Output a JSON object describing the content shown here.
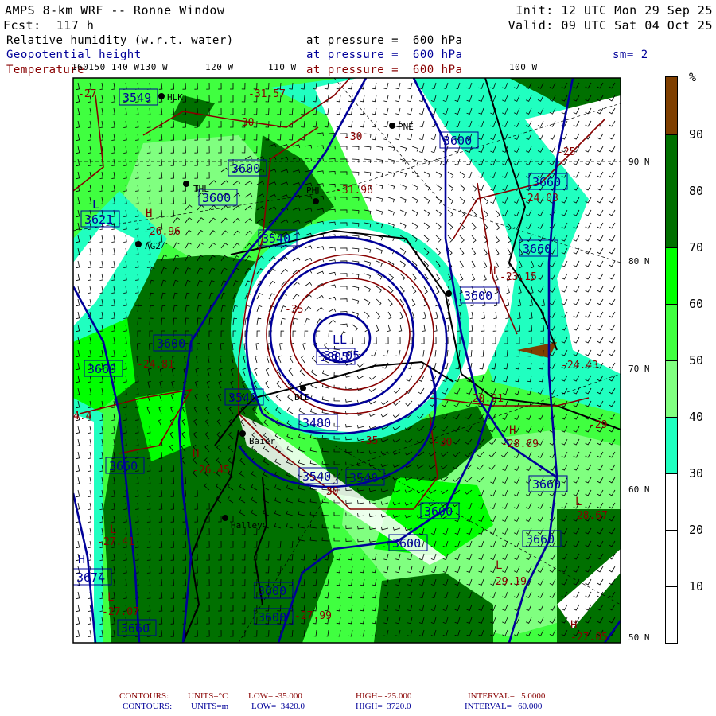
{
  "header": {
    "title": "AMPS 8-km WRF -- Ronne Window",
    "init": "Init: 12 UTC Mon 29 Sep 25",
    "forecast": "Fcst:  117 h",
    "valid": "Valid: 09 UTC Sat 04 Oct 25",
    "fields": [
      {
        "name": "Relative humidity (w.r.t. water)",
        "level": "at pressure =  600 hPa"
      },
      {
        "name": "Geopotential height",
        "level": "at pressure =  600 hPa"
      },
      {
        "name": "Temperature",
        "level": "at pressure =  600 hPa"
      }
    ],
    "smoothing": "sm= 2"
  },
  "colors": {
    "brown": "#7f3f00",
    "dark_green": "#007000",
    "bright_green": "#00ff00",
    "green": "#40ff40",
    "light_green": "#80ff80",
    "cyan": "#20ffc0",
    "white": "#ffffff",
    "height_contour": "#000099",
    "temp_contour": "#880000"
  },
  "colorbar": {
    "unit": "%",
    "ticks": [
      "90",
      "80",
      "70",
      "60",
      "50",
      "40",
      "30",
      "20",
      "10"
    ]
  },
  "lon_labels": [
    "160150 140 W130 W",
    "120 W",
    "110 W",
    "100 W"
  ],
  "lat_labels": [
    "90 N",
    "80 N",
    "70 N",
    "60 N",
    "50 N"
  ],
  "height_labels": [
    "3549",
    "3600",
    "3600",
    "3540",
    "3621",
    "3600",
    "3660",
    "3805",
    "3480",
    "3540",
    "3540",
    "3540",
    "3660",
    "3674",
    "3660",
    "3600",
    "3600",
    "3600",
    "3600",
    "3660",
    "3660",
    "3600",
    "3660",
    "3660",
    "3600"
  ],
  "center_marks": [
    "L",
    "LL",
    "H",
    "H",
    "H",
    "L",
    "L",
    "L",
    "H",
    "H",
    "H",
    "L"
  ],
  "temp_labels": [
    "-31.57",
    "-30",
    "-27",
    "-26.96",
    "-31.98",
    "-35",
    "-30",
    "-25",
    "-24.03",
    "-23.15",
    "-24.81",
    "4.4",
    "-26.45",
    "-27.41",
    "-27.07",
    "-30",
    "-27.99",
    "-24.43",
    "-20.01",
    "-29",
    "-28.69",
    "-30",
    "-35",
    "-28.67",
    "-29.19",
    "-27.05",
    "-38.05"
  ],
  "stations": [
    "HLK",
    "THL",
    "AG2",
    "PHL",
    "PNE",
    "BLD",
    "Baier",
    "Halley"
  ],
  "footer": {
    "temp": {
      "label": "CONTOURS:",
      "units": "UNITS=°C",
      "low": "LOW= -35.000",
      "high": "HIGH= -25.000",
      "interval": "INTERVAL=   5.0000"
    },
    "height": {
      "label": "CONTOURS:",
      "units": "UNITS=m",
      "low": "LOW=  3420.0",
      "high": "HIGH=  3720.0",
      "interval": "INTERVAL=   60.000"
    }
  }
}
